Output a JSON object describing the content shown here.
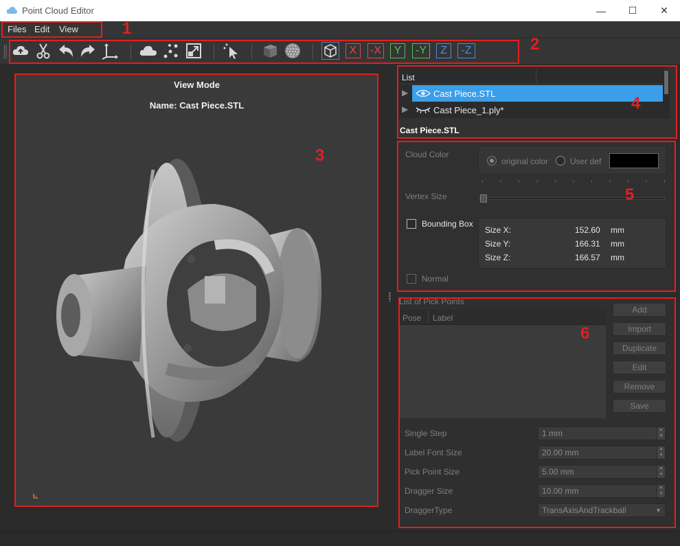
{
  "window": {
    "title": "Point Cloud Editor",
    "minimize": "—",
    "maximize": "☐",
    "close": "✕"
  },
  "menu": {
    "items": [
      "Files",
      "Edit",
      "View"
    ]
  },
  "toolbar": {
    "axis_buttons": [
      {
        "label": "X",
        "color": "#e04a4a"
      },
      {
        "label": "-X",
        "color": "#e04a4a"
      },
      {
        "label": "Y",
        "color": "#4fc24f"
      },
      {
        "label": "-Y",
        "color": "#4fc24f"
      },
      {
        "label": "Z",
        "color": "#4a8ae0"
      },
      {
        "label": "-Z",
        "color": "#4a8ae0"
      }
    ],
    "icons": [
      "cloud-upload-icon",
      "scissors-icon",
      "undo-icon",
      "redo-icon",
      "axes-icon",
      "cloud-icon",
      "points-icon",
      "scale-box-icon",
      "pointer-icon",
      "solid-cube-icon",
      "point-sphere-icon",
      "wire-cube-icon"
    ]
  },
  "annotations": {
    "n1": "1",
    "n2": "2",
    "n3": "3",
    "n4": "4",
    "n5": "5",
    "n6": "6"
  },
  "viewport": {
    "mode": "View Mode",
    "name": "Name: Cast Piece.STL"
  },
  "list": {
    "header": "List",
    "items": [
      {
        "label": "Cast Piece.STL",
        "selected": true,
        "icon": "eye-open-icon"
      },
      {
        "label": "Cast Piece_1.ply*",
        "selected": false,
        "icon": "eye-closed-icon"
      }
    ],
    "selected_name": "Cast Piece.STL"
  },
  "properties": {
    "cloud_color_label": "Cloud Color",
    "original_color": "original color",
    "user_def": "User def",
    "vertex_size_label": "Vertex Size",
    "bounding_box_label": "Bounding Box",
    "normal_label": "Normal",
    "size": [
      {
        "label": "Size X:",
        "value": "152.60",
        "unit": "mm"
      },
      {
        "label": "Size Y:",
        "value": "166.31",
        "unit": "mm"
      },
      {
        "label": "Size Z:",
        "value": "166.57",
        "unit": "mm"
      }
    ]
  },
  "pick_points": {
    "title": "List of Pick Points",
    "columns": [
      "Pose",
      "Label"
    ],
    "buttons": [
      "Add",
      "Import",
      "Duplicate",
      "Edit",
      "Remove",
      "Save"
    ],
    "settings": [
      {
        "label": "Single Step",
        "value": "1 mm"
      },
      {
        "label": "Label Font Size",
        "value": "20.00 mm"
      },
      {
        "label": "Pick Point Size",
        "value": "5.00 mm"
      },
      {
        "label": "Dragger Size",
        "value": "10.00 mm"
      }
    ],
    "dragger_type_label": "DraggerType",
    "dragger_type_value": "TransAxisAndTrackball"
  }
}
